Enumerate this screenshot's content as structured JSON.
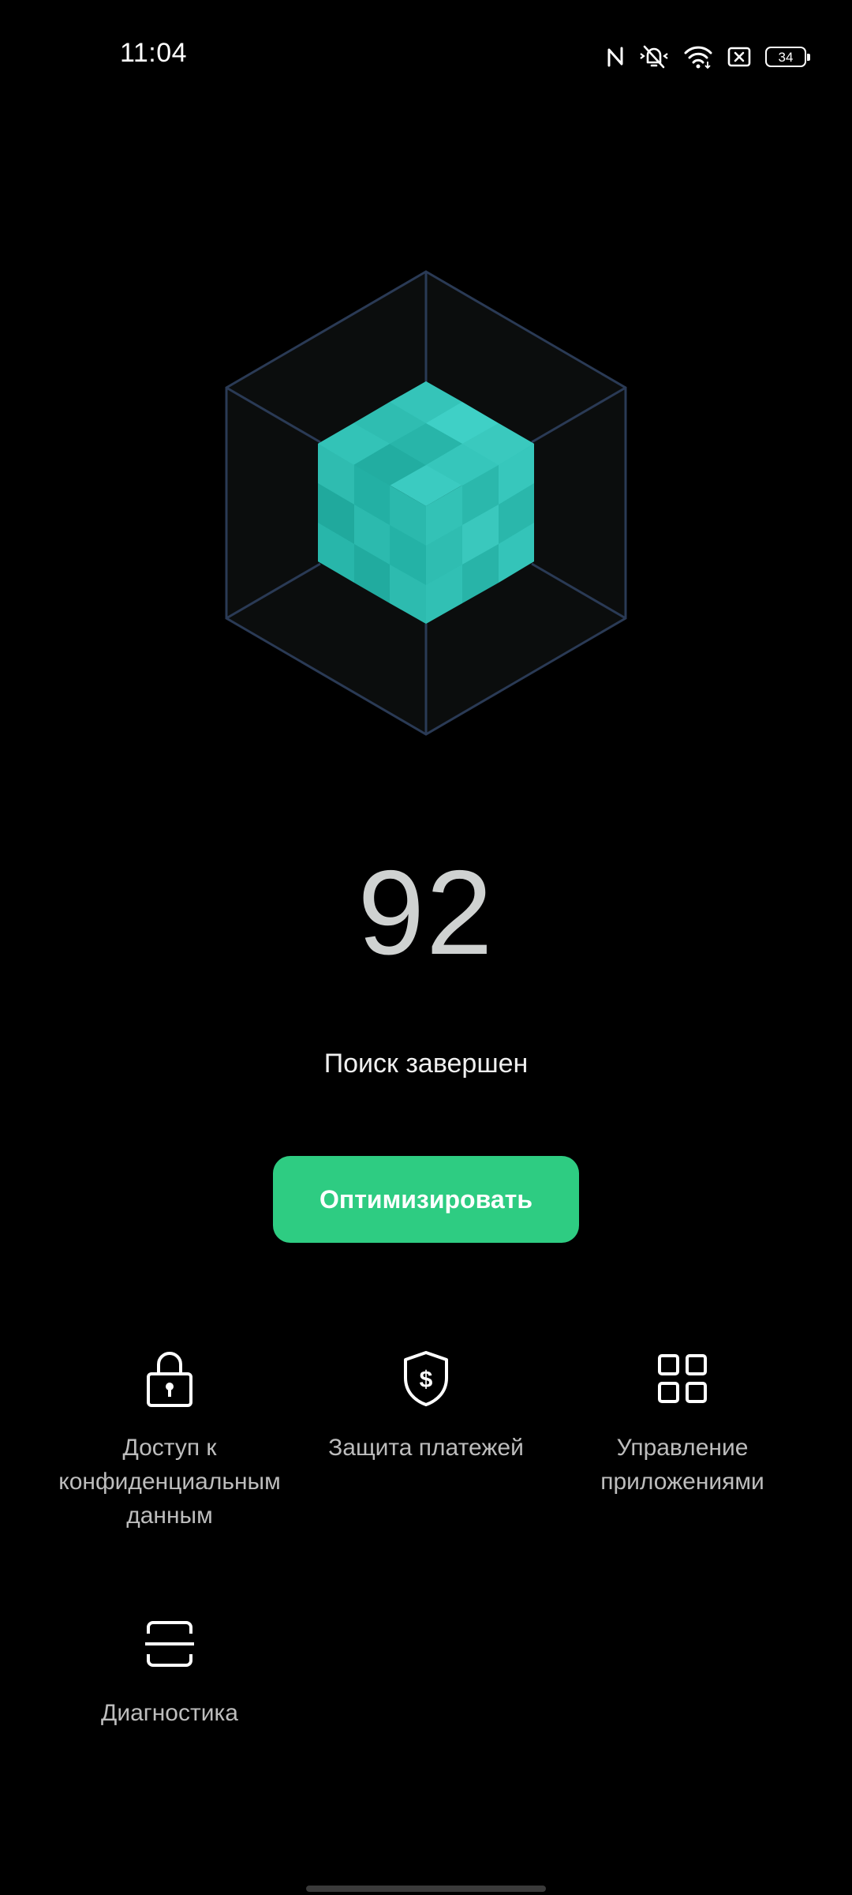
{
  "status_bar": {
    "time": "11:04",
    "battery": "34",
    "icons": [
      "nfc-icon",
      "silent-bell-icon",
      "wifi-icon",
      "sim-off-icon",
      "battery-icon"
    ]
  },
  "graphic": {
    "name": "cube-illustration",
    "accent_color": "#34c8bc",
    "frame_color": "#2a3a55"
  },
  "scan": {
    "score": "92",
    "status": "Поиск завершен"
  },
  "actions": {
    "optimize_label": "Оптимизировать",
    "optimize_color": "#2ecc82"
  },
  "features": [
    {
      "icon": "lock-icon",
      "label": "Доступ к конфиденциальным данным"
    },
    {
      "icon": "shield-dollar-icon",
      "label": "Защита платежей"
    },
    {
      "icon": "grid-apps-icon",
      "label": "Управление приложениями"
    },
    {
      "icon": "scan-icon",
      "label": "Диагностика"
    }
  ]
}
